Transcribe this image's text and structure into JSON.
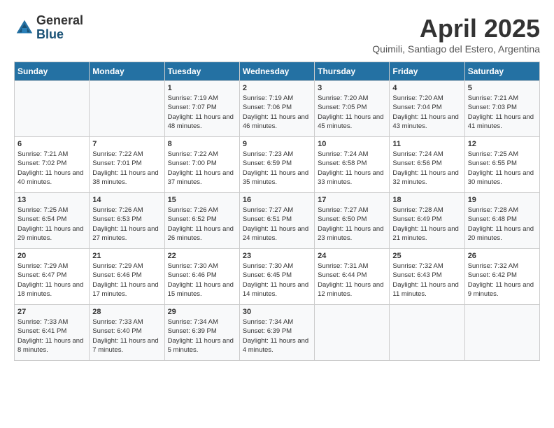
{
  "header": {
    "logo_line1": "General",
    "logo_line2": "Blue",
    "month": "April 2025",
    "location": "Quimili, Santiago del Estero, Argentina"
  },
  "days_of_week": [
    "Sunday",
    "Monday",
    "Tuesday",
    "Wednesday",
    "Thursday",
    "Friday",
    "Saturday"
  ],
  "weeks": [
    [
      {
        "day": "",
        "info": ""
      },
      {
        "day": "",
        "info": ""
      },
      {
        "day": "1",
        "info": "Sunrise: 7:19 AM\nSunset: 7:07 PM\nDaylight: 11 hours and 48 minutes."
      },
      {
        "day": "2",
        "info": "Sunrise: 7:19 AM\nSunset: 7:06 PM\nDaylight: 11 hours and 46 minutes."
      },
      {
        "day": "3",
        "info": "Sunrise: 7:20 AM\nSunset: 7:05 PM\nDaylight: 11 hours and 45 minutes."
      },
      {
        "day": "4",
        "info": "Sunrise: 7:20 AM\nSunset: 7:04 PM\nDaylight: 11 hours and 43 minutes."
      },
      {
        "day": "5",
        "info": "Sunrise: 7:21 AM\nSunset: 7:03 PM\nDaylight: 11 hours and 41 minutes."
      }
    ],
    [
      {
        "day": "6",
        "info": "Sunrise: 7:21 AM\nSunset: 7:02 PM\nDaylight: 11 hours and 40 minutes."
      },
      {
        "day": "7",
        "info": "Sunrise: 7:22 AM\nSunset: 7:01 PM\nDaylight: 11 hours and 38 minutes."
      },
      {
        "day": "8",
        "info": "Sunrise: 7:22 AM\nSunset: 7:00 PM\nDaylight: 11 hours and 37 minutes."
      },
      {
        "day": "9",
        "info": "Sunrise: 7:23 AM\nSunset: 6:59 PM\nDaylight: 11 hours and 35 minutes."
      },
      {
        "day": "10",
        "info": "Sunrise: 7:24 AM\nSunset: 6:58 PM\nDaylight: 11 hours and 33 minutes."
      },
      {
        "day": "11",
        "info": "Sunrise: 7:24 AM\nSunset: 6:56 PM\nDaylight: 11 hours and 32 minutes."
      },
      {
        "day": "12",
        "info": "Sunrise: 7:25 AM\nSunset: 6:55 PM\nDaylight: 11 hours and 30 minutes."
      }
    ],
    [
      {
        "day": "13",
        "info": "Sunrise: 7:25 AM\nSunset: 6:54 PM\nDaylight: 11 hours and 29 minutes."
      },
      {
        "day": "14",
        "info": "Sunrise: 7:26 AM\nSunset: 6:53 PM\nDaylight: 11 hours and 27 minutes."
      },
      {
        "day": "15",
        "info": "Sunrise: 7:26 AM\nSunset: 6:52 PM\nDaylight: 11 hours and 26 minutes."
      },
      {
        "day": "16",
        "info": "Sunrise: 7:27 AM\nSunset: 6:51 PM\nDaylight: 11 hours and 24 minutes."
      },
      {
        "day": "17",
        "info": "Sunrise: 7:27 AM\nSunset: 6:50 PM\nDaylight: 11 hours and 23 minutes."
      },
      {
        "day": "18",
        "info": "Sunrise: 7:28 AM\nSunset: 6:49 PM\nDaylight: 11 hours and 21 minutes."
      },
      {
        "day": "19",
        "info": "Sunrise: 7:28 AM\nSunset: 6:48 PM\nDaylight: 11 hours and 20 minutes."
      }
    ],
    [
      {
        "day": "20",
        "info": "Sunrise: 7:29 AM\nSunset: 6:47 PM\nDaylight: 11 hours and 18 minutes."
      },
      {
        "day": "21",
        "info": "Sunrise: 7:29 AM\nSunset: 6:46 PM\nDaylight: 11 hours and 17 minutes."
      },
      {
        "day": "22",
        "info": "Sunrise: 7:30 AM\nSunset: 6:46 PM\nDaylight: 11 hours and 15 minutes."
      },
      {
        "day": "23",
        "info": "Sunrise: 7:30 AM\nSunset: 6:45 PM\nDaylight: 11 hours and 14 minutes."
      },
      {
        "day": "24",
        "info": "Sunrise: 7:31 AM\nSunset: 6:44 PM\nDaylight: 11 hours and 12 minutes."
      },
      {
        "day": "25",
        "info": "Sunrise: 7:32 AM\nSunset: 6:43 PM\nDaylight: 11 hours and 11 minutes."
      },
      {
        "day": "26",
        "info": "Sunrise: 7:32 AM\nSunset: 6:42 PM\nDaylight: 11 hours and 9 minutes."
      }
    ],
    [
      {
        "day": "27",
        "info": "Sunrise: 7:33 AM\nSunset: 6:41 PM\nDaylight: 11 hours and 8 minutes."
      },
      {
        "day": "28",
        "info": "Sunrise: 7:33 AM\nSunset: 6:40 PM\nDaylight: 11 hours and 7 minutes."
      },
      {
        "day": "29",
        "info": "Sunrise: 7:34 AM\nSunset: 6:39 PM\nDaylight: 11 hours and 5 minutes."
      },
      {
        "day": "30",
        "info": "Sunrise: 7:34 AM\nSunset: 6:39 PM\nDaylight: 11 hours and 4 minutes."
      },
      {
        "day": "",
        "info": ""
      },
      {
        "day": "",
        "info": ""
      },
      {
        "day": "",
        "info": ""
      }
    ]
  ]
}
